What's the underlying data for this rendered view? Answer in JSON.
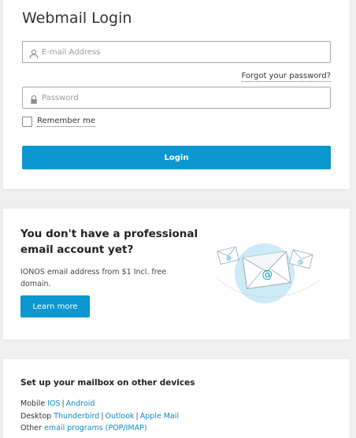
{
  "login": {
    "title": "Webmail Login",
    "email_placeholder": "E-mail Address",
    "forgot_label": "Forgot your password?",
    "password_placeholder": "Password",
    "remember_label": "Remember me",
    "login_label": "Login"
  },
  "promo": {
    "title": "You don't have a professional email account yet?",
    "text": "IONOS email address from $1 Incl. free domain.",
    "button_label": "Learn more"
  },
  "devices": {
    "title": "Set up your mailbox on other devices",
    "mobile": {
      "prefix": "Mobile",
      "links": [
        "IOS",
        "Android"
      ]
    },
    "desktop": {
      "prefix": "Desktop",
      "links": [
        "Thunderbird",
        "Outlook",
        "Apple Mail"
      ]
    },
    "other": {
      "prefix": "Other",
      "link": "email programs (POP/IMAP)"
    }
  },
  "colors": {
    "accent": "#0b97cf",
    "link": "#0b8ac2",
    "background": "#efefef"
  },
  "icons": [
    "user-icon",
    "lock-icon",
    "envelope-illustration"
  ]
}
